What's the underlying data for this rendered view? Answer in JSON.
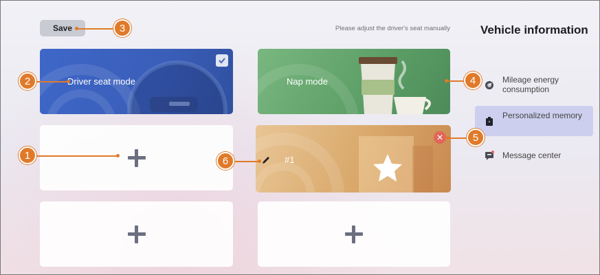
{
  "toolbar": {
    "save_label": "Save"
  },
  "hint_text": "Please adjust the driver's seat manually",
  "cards": {
    "driver_label": "Driver seat mode",
    "nap_label": "Nap mode",
    "custom_label": "#1"
  },
  "panel": {
    "title": "Vehicle information",
    "items": [
      {
        "label": "Mileage energy consumption",
        "icon": "speedometer-icon",
        "selected": false
      },
      {
        "label": "Personalized memory",
        "icon": "memory-icon",
        "selected": true
      },
      {
        "label": "Message center",
        "icon": "message-icon",
        "selected": false
      }
    ]
  },
  "callouts": [
    "1",
    "2",
    "3",
    "4",
    "5",
    "6"
  ],
  "colors": {
    "callout": "#e07a2a",
    "driver_card": "#3e67c8",
    "nap_card": "#5c9e66",
    "custom_card": "#d9a86a",
    "selected_item": "#ccd0ee",
    "close": "#e0665a"
  }
}
